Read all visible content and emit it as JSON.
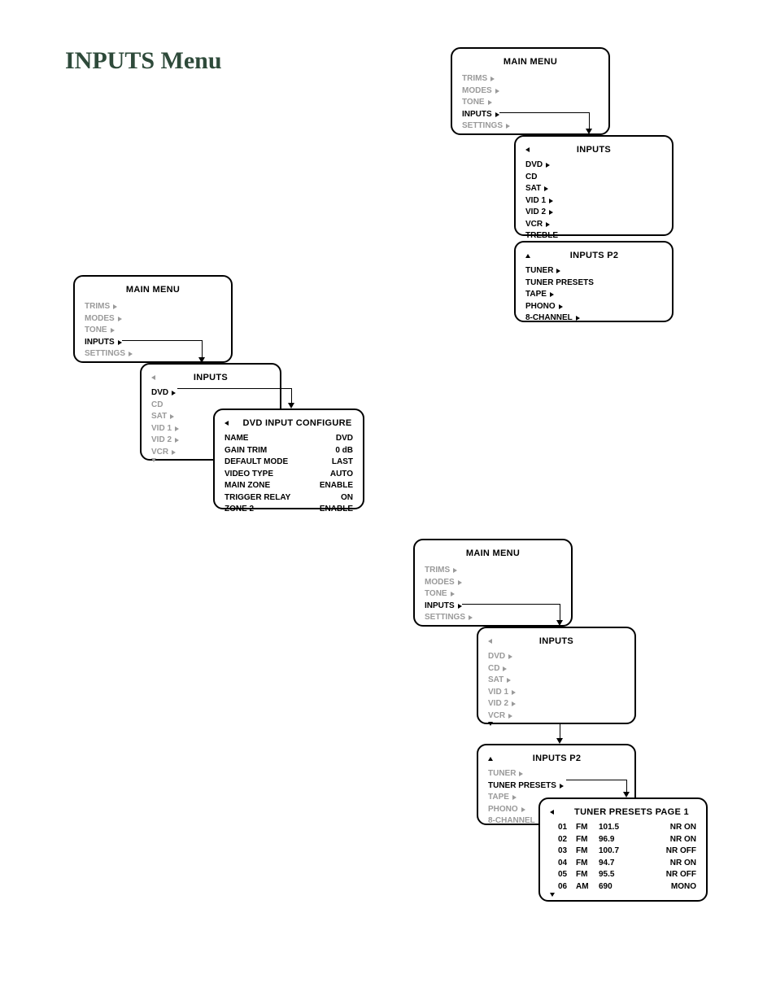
{
  "page_title": "INPUTS Menu",
  "main_menu": {
    "title": "MAIN MENU",
    "items": [
      "TRIMS",
      "MODES",
      "TONE",
      "INPUTS",
      "SETTINGS"
    ]
  },
  "inputs": {
    "title": "INPUTS",
    "items": [
      "DVD",
      "CD",
      "SAT",
      "VID 1",
      "VID 2",
      "VCR",
      "TREBLE"
    ]
  },
  "inputs_p2": {
    "title": "INPUTS P2",
    "items": [
      "TUNER",
      "TUNER PRESETS",
      "TAPE",
      "PHONO",
      "8-CHANNEL"
    ]
  },
  "dvd_config": {
    "title": "DVD INPUT CONFIGURE",
    "rows": [
      {
        "k": "NAME",
        "v": "DVD"
      },
      {
        "k": "GAIN TRIM",
        "v": "0 dB"
      },
      {
        "k": "DEFAULT MODE",
        "v": "LAST"
      },
      {
        "k": "VIDEO TYPE",
        "v": "AUTO"
      },
      {
        "k": "MAIN ZONE",
        "v": "ENABLE"
      },
      {
        "k": "TRIGGER RELAY",
        "v": "ON"
      },
      {
        "k": "ZONE 2",
        "v": "ENABLE"
      }
    ]
  },
  "tuner_presets": {
    "title": "TUNER PRESETS PAGE 1",
    "rows": [
      {
        "n": "01",
        "band": "FM",
        "freq": "101.5",
        "nr": "NR ON"
      },
      {
        "n": "02",
        "band": "FM",
        "freq": "96.9",
        "nr": "NR ON"
      },
      {
        "n": "03",
        "band": "FM",
        "freq": "100.7",
        "nr": "NR OFF"
      },
      {
        "n": "04",
        "band": "FM",
        "freq": "94.7",
        "nr": "NR ON"
      },
      {
        "n": "05",
        "band": "FM",
        "freq": "95.5",
        "nr": "NR OFF"
      },
      {
        "n": "06",
        "band": "AM",
        "freq": "690",
        "nr": "MONO"
      }
    ]
  }
}
